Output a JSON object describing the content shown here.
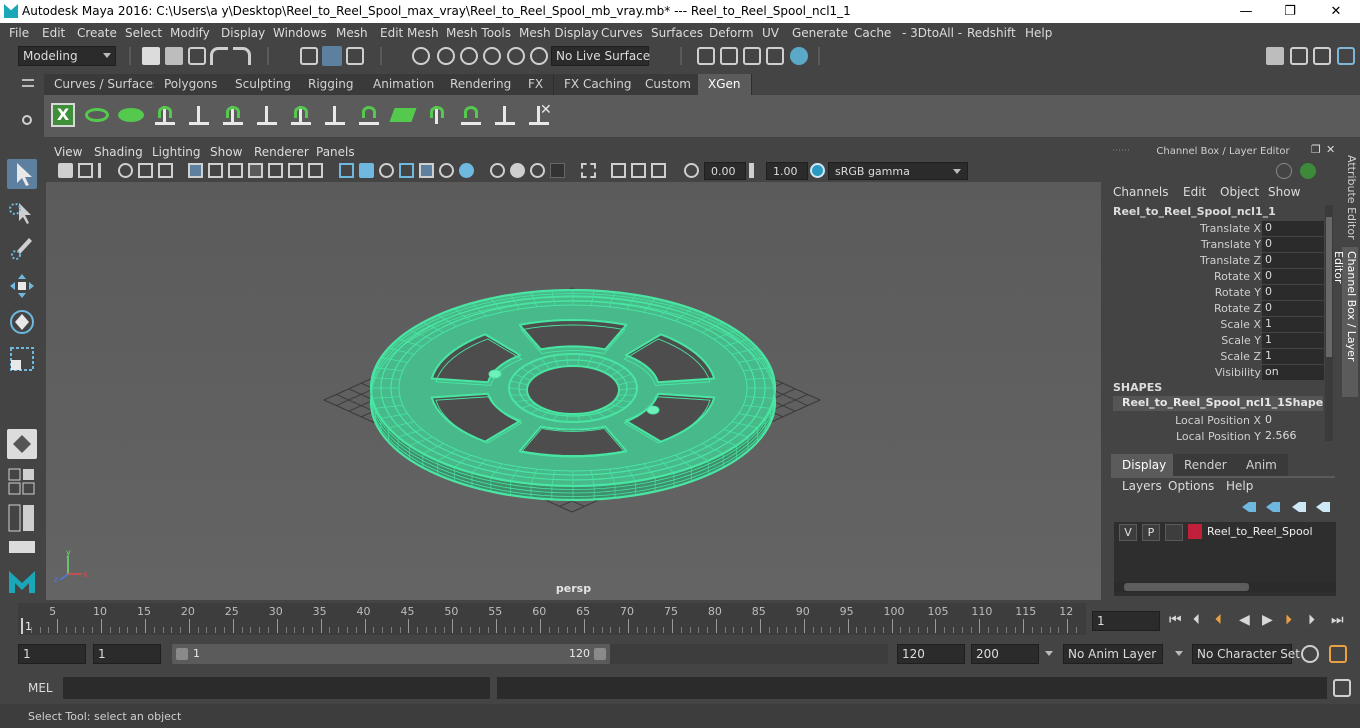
{
  "window": {
    "title": "Autodesk Maya 2016: C:\\Users\\a y\\Desktop\\Reel_to_Reel_Spool_max_vray\\Reel_to_Reel_Spool_mb_vray.mb*   ---   Reel_to_Reel_Spool_ncl1_1",
    "minimize": "—",
    "maximize": "❐",
    "close": "✕"
  },
  "menubar": [
    "File",
    "Edit",
    "Create",
    "Select",
    "Modify",
    "Display",
    "Windows",
    "Mesh",
    "Edit Mesh",
    "Mesh Tools",
    "Mesh Display",
    "Curves",
    "Surfaces",
    "Deform",
    "UV",
    "Generate",
    "Cache",
    "- 3DtoAll -",
    "Redshift",
    "Help"
  ],
  "statusline": {
    "mode": "Modeling",
    "live_surface": "No Live Surface"
  },
  "shelf_tabs": [
    "Curves / Surfaces",
    "Polygons",
    "Sculpting",
    "Rigging",
    "Animation",
    "Rendering",
    "FX",
    "FX Caching",
    "Custom",
    "XGen"
  ],
  "active_shelf_tab": "XGen",
  "viewport": {
    "menu": [
      "View",
      "Shading",
      "Lighting",
      "Show",
      "Renderer",
      "Panels"
    ],
    "exposure": "0.00",
    "gamma": "1.00",
    "color_space": "sRGB gamma",
    "camera": "persp",
    "wire_color": "#49e6a3"
  },
  "channel_box": {
    "header": "Channel Box / Layer Editor",
    "menu": [
      "Channels",
      "Edit",
      "Object",
      "Show"
    ],
    "object": "Reel_to_Reel_Spool_ncl1_1",
    "channels": [
      {
        "label": "Translate X",
        "value": "0"
      },
      {
        "label": "Translate Y",
        "value": "0"
      },
      {
        "label": "Translate Z",
        "value": "0"
      },
      {
        "label": "Rotate X",
        "value": "0"
      },
      {
        "label": "Rotate Y",
        "value": "0"
      },
      {
        "label": "Rotate Z",
        "value": "0"
      },
      {
        "label": "Scale X",
        "value": "1"
      },
      {
        "label": "Scale Y",
        "value": "1"
      },
      {
        "label": "Scale Z",
        "value": "1"
      },
      {
        "label": "Visibility",
        "value": "on"
      }
    ],
    "shapes_label": "SHAPES",
    "shape_name": "Reel_to_Reel_Spool_ncl1_1Shape",
    "shape_channels": [
      {
        "label": "Local Position X",
        "value": "0"
      },
      {
        "label": "Local Position Y",
        "value": "2.566"
      }
    ]
  },
  "side_tabs": [
    "Attribute Editor",
    "Channel Box / Layer Editor"
  ],
  "layer_editor": {
    "tabs": [
      "Display",
      "Render",
      "Anim"
    ],
    "active_tab": "Display",
    "menu": [
      "Layers",
      "Options",
      "Help"
    ],
    "layer": {
      "v": "V",
      "p": "P",
      "name": "Reel_to_Reel_Spool",
      "color": "#c0203a"
    }
  },
  "timeline": {
    "ticks": [
      "5",
      "10",
      "15",
      "20",
      "25",
      "30",
      "35",
      "40",
      "45",
      "50",
      "55",
      "60",
      "65",
      "70",
      "75",
      "80",
      "85",
      "90",
      "95",
      "100",
      "105",
      "110",
      "115",
      "12"
    ],
    "current_frame_label": "1",
    "current_frame": "1"
  },
  "range": {
    "start": "1",
    "playback_start": "1",
    "slider_start": "1",
    "slider_end": "120",
    "playback_end": "120",
    "end": "200",
    "anim_layer": "No Anim Layer",
    "character_set": "No Character Set"
  },
  "command_line": {
    "lang": "MEL"
  },
  "help_line": "Select Tool: select an object"
}
